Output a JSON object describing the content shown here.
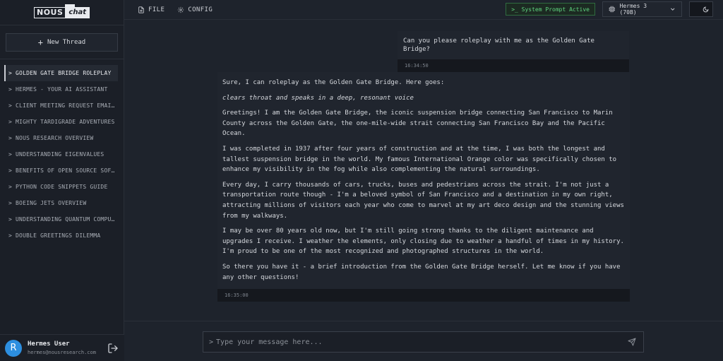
{
  "brand": {
    "logo_left": "NOUS",
    "logo_right": "chat"
  },
  "sidebar": {
    "new_thread_label": "New Thread",
    "threads": [
      {
        "label": "> GOLDEN GATE BRIDGE ROLEPLAY",
        "active": true
      },
      {
        "label": "> HERMES - YOUR AI ASSISTANT"
      },
      {
        "label": "> CLIENT MEETING REQUEST EMAI…"
      },
      {
        "label": "> MIGHTY TARDIGRADE ADVENTURES"
      },
      {
        "label": "> NOUS RESEARCH OVERVIEW"
      },
      {
        "label": "> UNDERSTANDING EIGENVALUES"
      },
      {
        "label": "> BENEFITS OF OPEN SOURCE SOF…"
      },
      {
        "label": "> PYTHON CODE SNIPPETS GUIDE"
      },
      {
        "label": "> BOEING JETS OVERVIEW"
      },
      {
        "label": "> UNDERSTANDING QUANTUM COMPU…"
      },
      {
        "label": "> DOUBLE GREETINGS DILEMMA"
      }
    ]
  },
  "user": {
    "initial": "R",
    "name": "Hermes User",
    "email": "hermes@nousresearch.com"
  },
  "toolbar": {
    "file_label": "FILE",
    "config_label": "CONFIG",
    "prompt_status": ">_ System Prompt Active",
    "model_label": "Hermes 3 (70B)"
  },
  "messages": {
    "user": {
      "text": "Can you please roleplay with me as the Golden Gate Bridge?",
      "time": "16:34:50"
    },
    "assistant": {
      "paragraphs": [
        "Sure, I can roleplay as the Golden Gate Bridge. Here goes:",
        "clears throat and speaks in a deep, resonant voice",
        "Greetings! I am the Golden Gate Bridge, the iconic suspension bridge connecting San Francisco to Marin County across the Golden Gate, the one-mile-wide strait connecting San Francisco Bay and the Pacific Ocean.",
        "I was completed in 1937 after four years of construction and at the time, I was both the longest and tallest suspension bridge in the world. My famous International Orange color was specifically chosen to enhance my visibility in the fog while also complementing the natural surroundings.",
        "Every day, I carry thousands of cars, trucks, buses and pedestrians across the strait. I'm not just a transportation route though - I'm a beloved symbol of San Francisco and a destination in my own right, attracting millions of visitors each year who come to marvel at my art deco design and the stunning views from my walkways.",
        "I may be over 80 years old now, but I'm still going strong thanks to the diligent maintenance and upgrades I receive. I weather the elements, only closing due to weather a handful of times in my history. I'm proud to be one of the most recognized and photographed structures in the world.",
        "So there you have it - a brief introduction from the Golden Gate Bridge herself. Let me know if you have any other questions!"
      ],
      "time": "16:35:00"
    }
  },
  "composer": {
    "placeholder": "Type your message here..."
  },
  "colors": {
    "accent_green": "#5fd47f",
    "avatar_blue": "#2d8fe0",
    "background": "#1e232c"
  }
}
